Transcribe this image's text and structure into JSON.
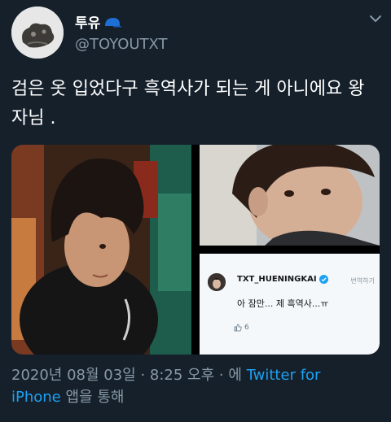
{
  "tweet": {
    "display_name": "투유",
    "handle": "@TOYOUTXT",
    "text": "검은 옷 입었다구 흑역사가 되는 게 아니에요 왕자님 .",
    "icons": {
      "name_badge": "blue-cap-icon",
      "more": "chevron-down-icon"
    }
  },
  "media_card": {
    "username": "TXT_HUENINGKAI",
    "translate_label": "번역하기",
    "text": "아 잠만... 제 흑역사...ㅠ",
    "likes": "6"
  },
  "meta": {
    "date_time": "2020년 08월 03일 · 8:25 오후 · 에",
    "source_line1": "Twitter for",
    "source_line2": "iPhone",
    "via": "앱을 통해"
  },
  "colors": {
    "background": "#15202b",
    "link": "#1da1f2",
    "secondary": "#8899a6"
  }
}
